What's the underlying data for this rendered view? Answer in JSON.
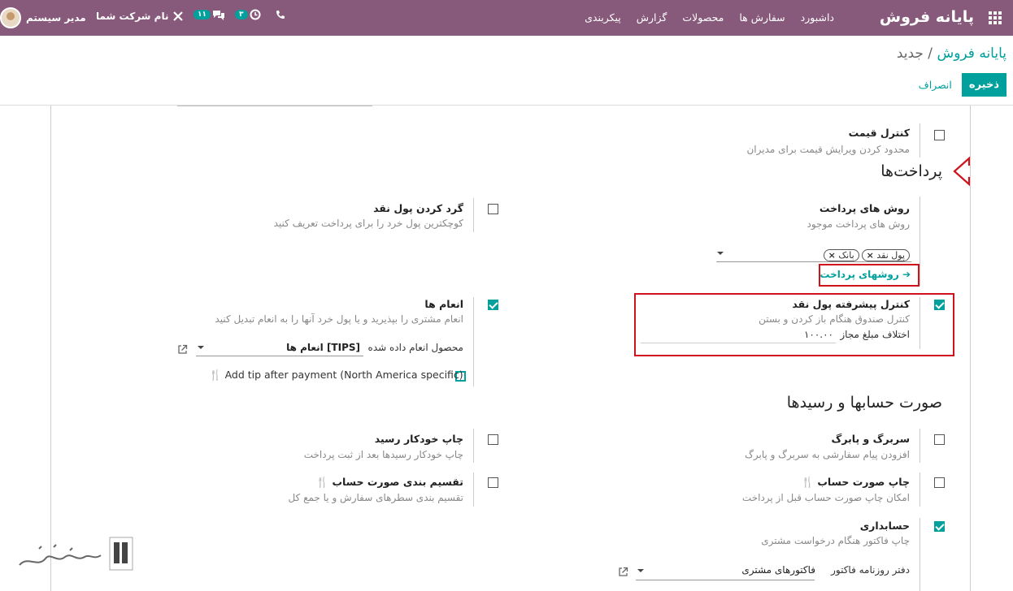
{
  "topbar": {
    "brand": "پایانه فروش",
    "menu": [
      "داشبورد",
      "سفارش ها",
      "محصولات",
      "گزارش",
      "پیکربندی"
    ],
    "user": "مدیر سیستم",
    "company": "نام شرکت شما",
    "chat_count": "۱۱",
    "activity_count": "۳"
  },
  "breadcrumb": {
    "root": "پایانه فروش",
    "sep": " / ",
    "current": "جدید"
  },
  "actions": {
    "save": "ذخیره",
    "discard": "انصراف"
  },
  "sections": {
    "price_control": {
      "title": "کنترل قیمت",
      "desc": "محدود کردن ویرایش قیمت برای مدیران"
    },
    "payments": {
      "heading": "پرداخت‌ها"
    },
    "payment_methods": {
      "title": "روش های پرداخت",
      "desc": "روش های پرداخت موجود",
      "tags": [
        "پول نقد",
        "بانک"
      ],
      "link": "روشهای پرداخت"
    },
    "cash_rounding": {
      "title": "گرد کردن پول نقد",
      "desc": "کوچکترین پول خرد را برای پرداخت تعریف کنید"
    },
    "cash_control": {
      "title": "کنترل پیشرفته پول نقد",
      "desc": "کنترل صندوق هنگام باز کردن و بستن",
      "diff_label": "اختلاف مبلغ مجاز",
      "diff_value": "۱۰۰.۰۰"
    },
    "tips": {
      "title": "انعام ها",
      "desc": "انعام مشتری را بپذیرید و یا پول خرد آنها را به انعام تبدیل کنید",
      "product_label": "محصول انعام داده شده",
      "product_value": "[TIPS] انعام ها",
      "after_payment": "Add tip after payment (North America specific)"
    },
    "bills": {
      "heading": "صورت حسابها و رسیدها"
    },
    "header_footer": {
      "title": "سربرگ و پابرگ",
      "desc": "افزودن پیام سفارشی به سربرگ و پابرگ"
    },
    "auto_print": {
      "title": "چاپ خودکار رسید",
      "desc": "چاپ خودکار رسیدها بعد از ثبت پرداخت"
    },
    "print_bill": {
      "title": "چاپ صورت حساب",
      "desc": "امکان چاپ صورت حساب قبل از پرداخت"
    },
    "split_bill": {
      "title": "تقسیم بندی صورت حساب",
      "desc": "تقسیم بندی سطرهای سفارش و یا جمع کل"
    },
    "accounting": {
      "title": "حسابداری",
      "desc": "چاپ فاکتور هنگام درخواست مشتری",
      "journal_label": "دفتر روزنامه فاکتور",
      "journal_value": "فاکتورهای مشتری"
    }
  },
  "colors": {
    "topbar": "#875a7b",
    "accent": "#00a09d",
    "highlight": "#d0121c"
  }
}
